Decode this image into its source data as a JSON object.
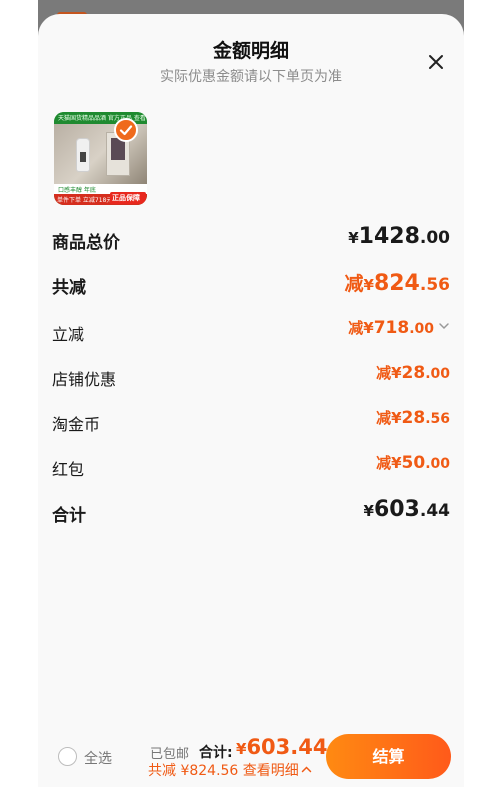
{
  "modal": {
    "title": "金额明细",
    "subtitle": "实际优惠金额请以下单页为准"
  },
  "product_image": {
    "banner": "天猫国货精品品酒 官方正品 查看详情",
    "promo": "口感丰醇 年底",
    "promo_red": "单件下单 立减718元",
    "guarantee": "正品保障"
  },
  "rows": [
    {
      "label": "商品总价",
      "prefix": "",
      "yen": "¥",
      "int": "1428",
      "dec": ".00",
      "style": "total",
      "chevron": false
    },
    {
      "label": "共减",
      "prefix": "减",
      "yen": "¥",
      "int": "824",
      "dec": ".56",
      "style": "reduction-total",
      "chevron": false
    },
    {
      "label": "立减",
      "prefix": "减",
      "yen": "¥",
      "int": "718",
      "dec": ".00",
      "style": "reduction",
      "chevron": true
    },
    {
      "label": "店铺优惠",
      "prefix": "减",
      "yen": "¥",
      "int": "28",
      "dec": ".00",
      "style": "reduction",
      "chevron": false
    },
    {
      "label": "淘金币",
      "prefix": "减",
      "yen": "¥",
      "int": "28",
      "dec": ".56",
      "style": "reduction",
      "chevron": false
    },
    {
      "label": "红包",
      "prefix": "减",
      "yen": "¥",
      "int": "50",
      "dec": ".00",
      "style": "reduction",
      "chevron": false
    },
    {
      "label": "合计",
      "prefix": "",
      "yen": "¥",
      "int": "603",
      "dec": ".44",
      "style": "total",
      "chevron": false
    }
  ],
  "footer": {
    "select_all": "全选",
    "shipping": "已包邮",
    "total_label": "合计:",
    "total_yen": "¥",
    "total_value": "603.44",
    "reduction_text": "共减 ¥824.56",
    "detail_link": "查看明细",
    "checkout_label": "结算"
  },
  "colors": {
    "accent": "#f05a14",
    "checkout_gradient_start": "#ff8a12",
    "checkout_gradient_end": "#ff5a1a",
    "sheet_bg": "#f9f9f9"
  },
  "icons": {
    "close": "close-icon",
    "check": "check-icon",
    "chevron": "chevron-down-icon",
    "detail_chevron": "chevron-up-icon"
  }
}
